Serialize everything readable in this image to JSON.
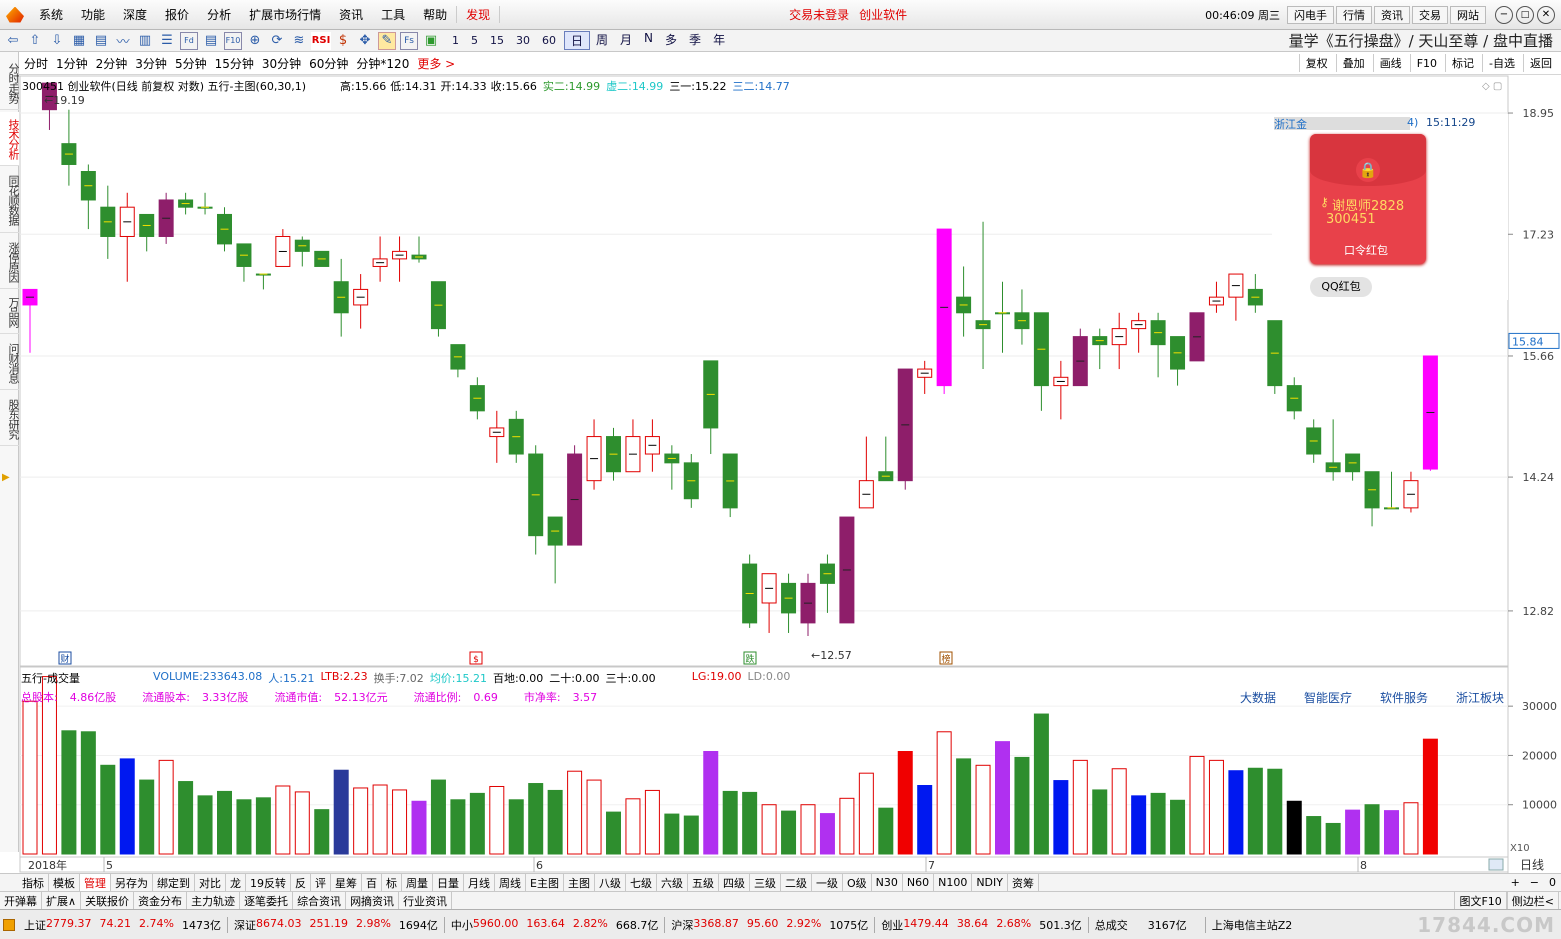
{
  "app": {
    "logo_icon": "flame-logo-icon",
    "menu": [
      "系统",
      "功能",
      "深度",
      "报价",
      "分析",
      "扩展市场行情",
      "资讯",
      "工具",
      "帮助"
    ],
    "menu_highlight": "发现",
    "login_status": "交易未登录",
    "stock_tag": "创业软件",
    "clock": "00:46:09 周三",
    "top_buttons": [
      "闪电手",
      "行情",
      "资讯",
      "交易",
      "网站"
    ]
  },
  "toolbar": {
    "icons": [
      "back-icon",
      "up-icon",
      "down-icon",
      "table-icon",
      "grid-icon",
      "line-chart-icon",
      "candle-icon",
      "list-icon",
      "fund-icon",
      "report-icon",
      "f10-icon",
      "zoom-icon",
      "refresh-icon",
      "macd-icon"
    ],
    "rsi": "RSI",
    "periods_small": [
      "1",
      "5",
      "15",
      "30",
      "60"
    ],
    "periods_big": [
      "日",
      "周",
      "月",
      "N",
      "多",
      "季",
      "年"
    ],
    "active_period": "日",
    "marquee": "量学《五行操盘》/ 天山至尊 / 盘中直播"
  },
  "periodbar": {
    "items": [
      "分时",
      "1分钟",
      "2分钟",
      "3分钟",
      "5分钟",
      "15分钟",
      "30分钟",
      "60分钟",
      "分钟*120"
    ],
    "more": "更多 >",
    "right": [
      "复权",
      "叠加",
      "画线",
      "F10",
      "标记",
      "-自选",
      "返回"
    ]
  },
  "side_tabs": [
    "分时走势",
    "技术分析",
    "同花顺数据",
    "涨停原因",
    "万品网",
    "问财消息",
    "股东研究"
  ],
  "main": {
    "title": "300451 创业软件(日线 前复权 对数) 五行-主图(60,30,1)",
    "stats": [
      {
        "k": "高:",
        "v": "15.66"
      },
      {
        "k": "低:",
        "v": "14.31"
      },
      {
        "k": "开:",
        "v": "14.33"
      },
      {
        "k": "收:",
        "v": "15.66"
      }
    ],
    "ind": [
      {
        "k": "实二:",
        "v": "14.99",
        "c": "#2e9a2e"
      },
      {
        "k": "虚二:",
        "v": "14.99",
        "c": "#1ec8c8"
      },
      {
        "k": "三一:",
        "v": "15.22",
        "c": "#000"
      },
      {
        "k": "三二:",
        "v": "14.77",
        "c": "#2070c8"
      }
    ],
    "high_mark": "19.19",
    "low_mark": "12.57",
    "price_ticks": [
      "18.95",
      "17.23",
      "15.66",
      "14.24",
      "12.82"
    ],
    "current_price": "15.84",
    "event_markers": [
      "财",
      "$",
      "跌",
      "榜"
    ]
  },
  "popup": {
    "header": "浙江金",
    "header_tail": "4)",
    "time": "15:11:29",
    "lock_icon": "lock-icon",
    "name": "谢恩师2828",
    "code": "300451",
    "envelope_label": "口令红包",
    "qq_button": "QQ红包"
  },
  "volume": {
    "title": "五行-成交量",
    "metrics": [
      {
        "k": "VOLUME:",
        "v": "233643.08",
        "c": "#2070c8"
      },
      {
        "k": "人:",
        "v": "15.21",
        "c": "#2070c8"
      },
      {
        "k": "LTB:",
        "v": "2.23",
        "c": "#e00000"
      },
      {
        "k": "换手:",
        "v": "7.02",
        "c": "#666"
      },
      {
        "k": "均价:",
        "v": "15.21",
        "c": "#1ec8c8"
      },
      {
        "k": "百地:",
        "v": "0.00",
        "c": "#000"
      },
      {
        "k": "二十:",
        "v": "0.00",
        "c": "#000"
      },
      {
        "k": "三十:",
        "v": "0.00",
        "c": "#000"
      },
      {
        "k": "LG:",
        "v": "19.00",
        "c": "#e00000"
      },
      {
        "k": "LD:",
        "v": "0.00",
        "c": "#888"
      }
    ],
    "fundamentals": [
      {
        "k": "总股本:",
        "v": "4.86亿股"
      },
      {
        "k": "流通股本:",
        "v": "3.33亿股"
      },
      {
        "k": "流通市值:",
        "v": "52.13亿元"
      },
      {
        "k": "流通比例:",
        "v": "0.69"
      },
      {
        "k": "市净率:",
        "v": "3.57"
      }
    ],
    "tags": [
      "大数据",
      "智能医疗",
      "软件服务",
      "浙江板块"
    ],
    "vol_ticks": [
      "30000",
      "20000",
      "10000"
    ],
    "zoom_tag": "X10"
  },
  "timeline": {
    "year": "2018年",
    "months": [
      "5",
      "6",
      "7",
      "8"
    ],
    "tail": "日线"
  },
  "tabs": [
    "指标",
    "模板",
    "管理",
    "另存为",
    "绑定到",
    "对比",
    "龙",
    "19反转",
    "反",
    "评",
    "星筹",
    "百",
    "标",
    "周量",
    "日量",
    "月线",
    "周线",
    "E主图",
    "主图",
    "八级",
    "七级",
    "六级",
    "五级",
    "四级",
    "三级",
    "二级",
    "一级",
    "O级",
    "N30",
    "N60",
    "N100",
    "NDIY",
    "资筹"
  ],
  "tabs_active": "管理",
  "btnrow": [
    "开弹幕",
    "扩展∧",
    "关联报价",
    "资金分布",
    "主力轨迹",
    "逐笔委托",
    "综合资讯",
    "网摘资讯",
    "行业资讯"
  ],
  "btnrow_right": [
    "图文F10",
    "侧边栏<"
  ],
  "status": [
    {
      "n": "上证",
      "p": "2779.37",
      "c": "74.21",
      "pct": "2.74%",
      "a": "1473亿"
    },
    {
      "n": "深证",
      "p": "8674.03",
      "c": "251.19",
      "pct": "2.98%",
      "a": "1694亿"
    },
    {
      "n": "中小",
      "p": "5960.00",
      "c": "163.64",
      "pct": "2.82%",
      "a": "668.7亿"
    },
    {
      "n": "沪深",
      "p": "3368.87",
      "c": "95.60",
      "pct": "2.92%",
      "a": "1075亿"
    },
    {
      "n": "创业",
      "p": "1479.44",
      "c": "38.64",
      "pct": "2.68%",
      "a": "501.3亿"
    }
  ],
  "status_total_label": "总成交",
  "status_total": "3167亿",
  "server": "上海电信主站Z2",
  "watermark": "17844.COM",
  "candles": [
    [
      16.5,
      16.3,
      16.5,
      15.7,
      "m"
    ],
    [
      19.0,
      19.4,
      19.4,
      18.7,
      "p"
    ],
    [
      18.5,
      18.2,
      19.0,
      17.9,
      "g"
    ],
    [
      18.1,
      17.7,
      18.2,
      17.3,
      "g"
    ],
    [
      17.6,
      17.2,
      17.9,
      16.9,
      "g"
    ],
    [
      17.2,
      17.6,
      17.8,
      16.6,
      "r"
    ],
    [
      17.5,
      17.2,
      17.5,
      17.0,
      "g"
    ],
    [
      17.2,
      17.7,
      17.8,
      17.1,
      "p"
    ],
    [
      17.7,
      17.6,
      17.8,
      17.5,
      "g"
    ],
    [
      17.6,
      17.6,
      17.8,
      17.5,
      "g"
    ],
    [
      17.5,
      17.1,
      17.6,
      17.0,
      "g"
    ],
    [
      17.1,
      16.8,
      17.1,
      16.6,
      "g"
    ],
    [
      16.7,
      16.7,
      16.7,
      16.5,
      "g"
    ],
    [
      16.8,
      17.2,
      17.3,
      16.8,
      "r"
    ],
    [
      17.15,
      17.0,
      17.2,
      16.8,
      "g"
    ],
    [
      17.0,
      16.8,
      17.0,
      16.8,
      "g"
    ],
    [
      16.6,
      16.2,
      16.9,
      15.9,
      "g"
    ],
    [
      16.3,
      16.5,
      16.7,
      16.0,
      "r"
    ],
    [
      16.8,
      16.9,
      17.2,
      16.6,
      "r"
    ],
    [
      16.9,
      17.0,
      17.2,
      16.6,
      "r"
    ],
    [
      16.95,
      16.9,
      17.2,
      16.85,
      "g"
    ],
    [
      16.6,
      16.0,
      16.6,
      15.9,
      "g"
    ],
    [
      15.8,
      15.5,
      15.8,
      15.4,
      "g"
    ],
    [
      15.3,
      15.0,
      15.4,
      14.9,
      "g"
    ],
    [
      14.7,
      14.8,
      15.0,
      14.4,
      "r"
    ],
    [
      14.9,
      14.5,
      15.0,
      14.4,
      "g"
    ],
    [
      14.5,
      13.6,
      14.6,
      13.4,
      "g"
    ],
    [
      13.8,
      13.5,
      13.8,
      13.1,
      "g"
    ],
    [
      13.5,
      14.5,
      14.6,
      13.5,
      "p"
    ],
    [
      14.2,
      14.7,
      14.9,
      14.1,
      "r"
    ],
    [
      14.7,
      14.3,
      14.8,
      14.2,
      "g"
    ],
    [
      14.3,
      14.7,
      14.9,
      14.3,
      "r"
    ],
    [
      14.5,
      14.7,
      14.9,
      14.3,
      "r"
    ],
    [
      14.5,
      14.4,
      14.6,
      14.1,
      "g"
    ],
    [
      14.4,
      14.0,
      14.5,
      13.9,
      "g"
    ],
    [
      14.8,
      15.6,
      15.6,
      14.5,
      "g"
    ],
    [
      14.5,
      13.9,
      14.5,
      13.8,
      "g"
    ],
    [
      13.3,
      12.7,
      13.4,
      12.65,
      "g"
    ],
    [
      12.9,
      13.2,
      13.2,
      12.6,
      "r"
    ],
    [
      13.1,
      12.8,
      13.2,
      12.6,
      "g"
    ],
    [
      12.7,
      13.1,
      13.2,
      12.57,
      "p"
    ],
    [
      13.1,
      13.3,
      13.4,
      12.8,
      "g"
    ],
    [
      12.7,
      13.8,
      13.8,
      12.7,
      "p"
    ],
    [
      13.9,
      14.2,
      14.7,
      13.9,
      "r"
    ],
    [
      14.3,
      14.2,
      14.7,
      14.2,
      "g"
    ],
    [
      14.2,
      15.5,
      15.5,
      14.1,
      "p"
    ],
    [
      15.4,
      15.5,
      15.6,
      15.2,
      "r"
    ],
    [
      15.3,
      17.3,
      17.3,
      15.2,
      "m"
    ],
    [
      16.4,
      16.2,
      16.8,
      15.9,
      "g"
    ],
    [
      16.1,
      16.0,
      17.4,
      15.5,
      "g"
    ],
    [
      16.2,
      16.2,
      16.6,
      15.7,
      "g"
    ],
    [
      16.0,
      16.2,
      16.5,
      15.8,
      "g"
    ],
    [
      16.2,
      15.3,
      16.2,
      15.0,
      "g"
    ],
    [
      15.3,
      15.4,
      15.6,
      14.9,
      "r"
    ],
    [
      15.3,
      15.9,
      16.0,
      15.3,
      "p"
    ],
    [
      15.9,
      15.8,
      16.0,
      15.5,
      "g"
    ],
    [
      15.8,
      16.0,
      16.2,
      15.5,
      "r"
    ],
    [
      16.0,
      16.1,
      16.2,
      15.7,
      "r"
    ],
    [
      16.1,
      15.8,
      16.2,
      15.4,
      "g"
    ],
    [
      15.9,
      15.5,
      15.9,
      15.3,
      "g"
    ],
    [
      15.6,
      16.2,
      16.2,
      15.6,
      "p"
    ],
    [
      16.3,
      16.4,
      16.6,
      16.2,
      "r"
    ],
    [
      16.4,
      16.7,
      16.7,
      16.1,
      "r"
    ],
    [
      16.5,
      16.3,
      16.7,
      16.2,
      "g"
    ],
    [
      16.1,
      15.3,
      16.1,
      15.2,
      "g"
    ],
    [
      15.3,
      15.0,
      15.4,
      14.9,
      "g"
    ],
    [
      14.8,
      14.5,
      14.9,
      14.4,
      "g"
    ],
    [
      14.3,
      14.4,
      14.9,
      14.2,
      "g"
    ],
    [
      14.5,
      14.3,
      14.5,
      14.2,
      "g"
    ],
    [
      14.3,
      13.9,
      14.3,
      13.7,
      "g"
    ],
    [
      13.9,
      13.9,
      14.3,
      13.9,
      "g"
    ],
    [
      13.9,
      14.2,
      14.3,
      13.85,
      "r"
    ],
    [
      14.33,
      15.66,
      15.66,
      14.31,
      "m"
    ]
  ],
  "volumes": [
    [
      31000,
      "r"
    ],
    [
      36000,
      "r"
    ],
    [
      25000,
      "g"
    ],
    [
      24800,
      "g"
    ],
    [
      18000,
      "g"
    ],
    [
      19300,
      "b"
    ],
    [
      15000,
      "g"
    ],
    [
      19000,
      "r"
    ],
    [
      14700,
      "g"
    ],
    [
      11800,
      "g"
    ],
    [
      12700,
      "g"
    ],
    [
      11000,
      "g"
    ],
    [
      11400,
      "g"
    ],
    [
      13800,
      "r"
    ],
    [
      12600,
      "r"
    ],
    [
      9000,
      "g"
    ],
    [
      17000,
      "n"
    ],
    [
      13400,
      "r"
    ],
    [
      14000,
      "r"
    ],
    [
      13000,
      "r"
    ],
    [
      10700,
      "p"
    ],
    [
      15000,
      "g"
    ],
    [
      11000,
      "g"
    ],
    [
      12300,
      "g"
    ],
    [
      13700,
      "r"
    ],
    [
      11000,
      "g"
    ],
    [
      14300,
      "g"
    ],
    [
      12900,
      "g"
    ],
    [
      16800,
      "r"
    ],
    [
      15000,
      "r"
    ],
    [
      8500,
      "g"
    ],
    [
      11200,
      "r"
    ],
    [
      12900,
      "r"
    ],
    [
      8100,
      "g"
    ],
    [
      7700,
      "g"
    ],
    [
      20800,
      "p"
    ],
    [
      12700,
      "g"
    ],
    [
      12500,
      "g"
    ],
    [
      10000,
      "r"
    ],
    [
      8700,
      "g"
    ],
    [
      10000,
      "r"
    ],
    [
      8200,
      "p"
    ],
    [
      11300,
      "r"
    ],
    [
      16400,
      "r"
    ],
    [
      9300,
      "g"
    ],
    [
      20800,
      "red"
    ],
    [
      13900,
      "b"
    ],
    [
      24800,
      "r"
    ],
    [
      19300,
      "g"
    ],
    [
      18000,
      "r"
    ],
    [
      22800,
      "p"
    ],
    [
      19600,
      "g"
    ],
    [
      28400,
      "g"
    ],
    [
      14900,
      "b"
    ],
    [
      19000,
      "r"
    ],
    [
      13000,
      "g"
    ],
    [
      17300,
      "r"
    ],
    [
      11800,
      "b"
    ],
    [
      12300,
      "g"
    ],
    [
      10900,
      "g"
    ],
    [
      19800,
      "r"
    ],
    [
      19000,
      "r"
    ],
    [
      16900,
      "b"
    ],
    [
      17400,
      "g"
    ],
    [
      17200,
      "g"
    ],
    [
      10700,
      "k"
    ],
    [
      7600,
      "g"
    ],
    [
      6200,
      "g"
    ],
    [
      8900,
      "p"
    ],
    [
      10000,
      "g"
    ],
    [
      8800,
      "p"
    ],
    [
      10400,
      "r"
    ],
    [
      23300,
      "red"
    ]
  ]
}
